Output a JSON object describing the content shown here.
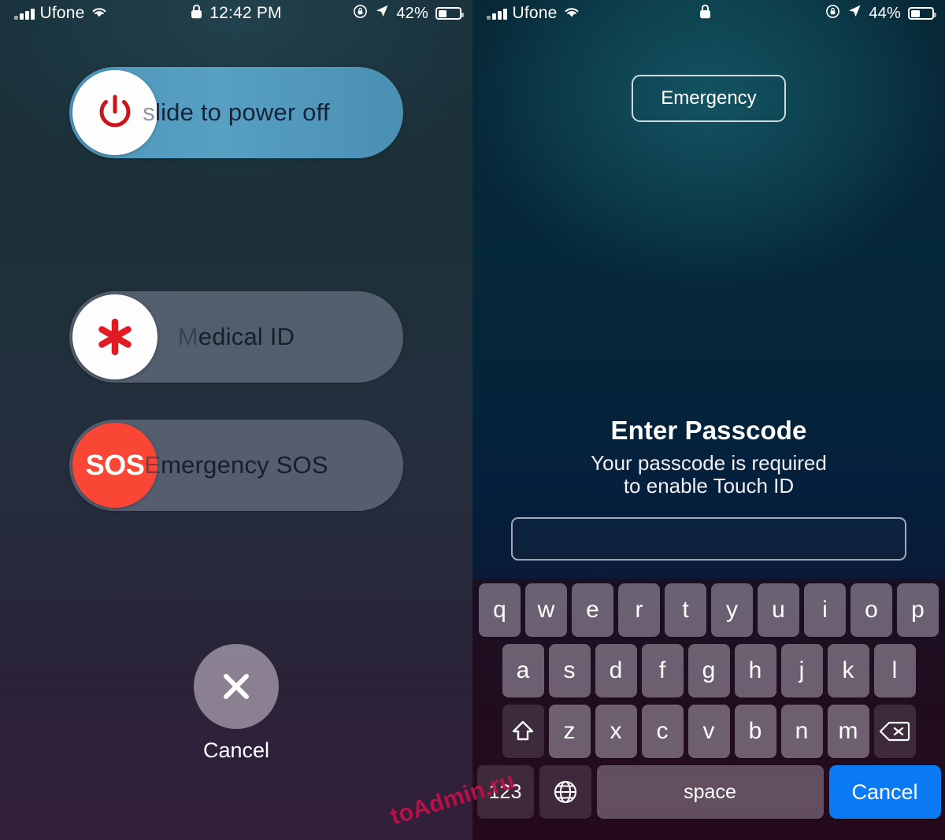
{
  "left": {
    "statusbar": {
      "carrier": "Ufone",
      "signal_icon": "cellular-bars-icon",
      "wifi_icon": "wifi-icon",
      "lock_icon": "lock-icon",
      "time": "12:42 PM",
      "rotation_lock_icon": "rotation-lock-icon",
      "location_icon": "location-arrow-icon",
      "battery_percent": "42%",
      "battery_level": 42,
      "battery_icon": "battery-icon"
    },
    "power_slider": {
      "label_dim": "s",
      "label_rest": "lide to power off",
      "icon": "power-icon",
      "track_color": "#4f96bb",
      "knob_color": "#fdfdfd",
      "icon_color": "#c9161b"
    },
    "medical_id": {
      "label_dim": "M",
      "label_rest": "edical ID",
      "icon": "medical-asterisk-icon",
      "knob_color": "#fdfdfd",
      "icon_color": "#e01b24"
    },
    "emergency_sos": {
      "label_dim": "E",
      "label_rest": "mergency SOS",
      "icon": "sos-icon",
      "icon_text": "SOS",
      "knob_color": "#fa4635"
    },
    "cancel": {
      "label": "Cancel",
      "icon": "close-x-icon",
      "circle_color": "#a59bac"
    }
  },
  "right": {
    "statusbar": {
      "carrier": "Ufone",
      "signal_icon": "cellular-bars-icon",
      "wifi_icon": "wifi-icon",
      "lock_icon": "lock-icon",
      "time": "",
      "rotation_lock_icon": "rotation-lock-icon",
      "location_icon": "location-arrow-icon",
      "battery_percent": "44%",
      "battery_level": 44,
      "battery_icon": "battery-icon"
    },
    "emergency_button": {
      "label": "Emergency"
    },
    "passcode": {
      "title": "Enter Passcode",
      "subtitle_line1": "Your passcode is required",
      "subtitle_line2": "to enable Touch ID",
      "field_value": "",
      "field_placeholder": ""
    },
    "keyboard": {
      "row1": [
        "q",
        "w",
        "e",
        "r",
        "t",
        "y",
        "u",
        "i",
        "o",
        "p"
      ],
      "row2": [
        "a",
        "s",
        "d",
        "f",
        "g",
        "h",
        "j",
        "k",
        "l"
      ],
      "row3": [
        "z",
        "x",
        "c",
        "v",
        "b",
        "n",
        "m"
      ],
      "shift_icon": "shift-arrow-icon",
      "backspace_icon": "backspace-delete-icon",
      "numbers_label": "123",
      "globe_icon": "globe-language-icon",
      "space_label": "space",
      "cancel_label": "Cancel",
      "cancel_color": "#0a7bf5"
    }
  },
  "watermark": {
    "text": "toAdmin.ru",
    "color": "#c01048"
  }
}
